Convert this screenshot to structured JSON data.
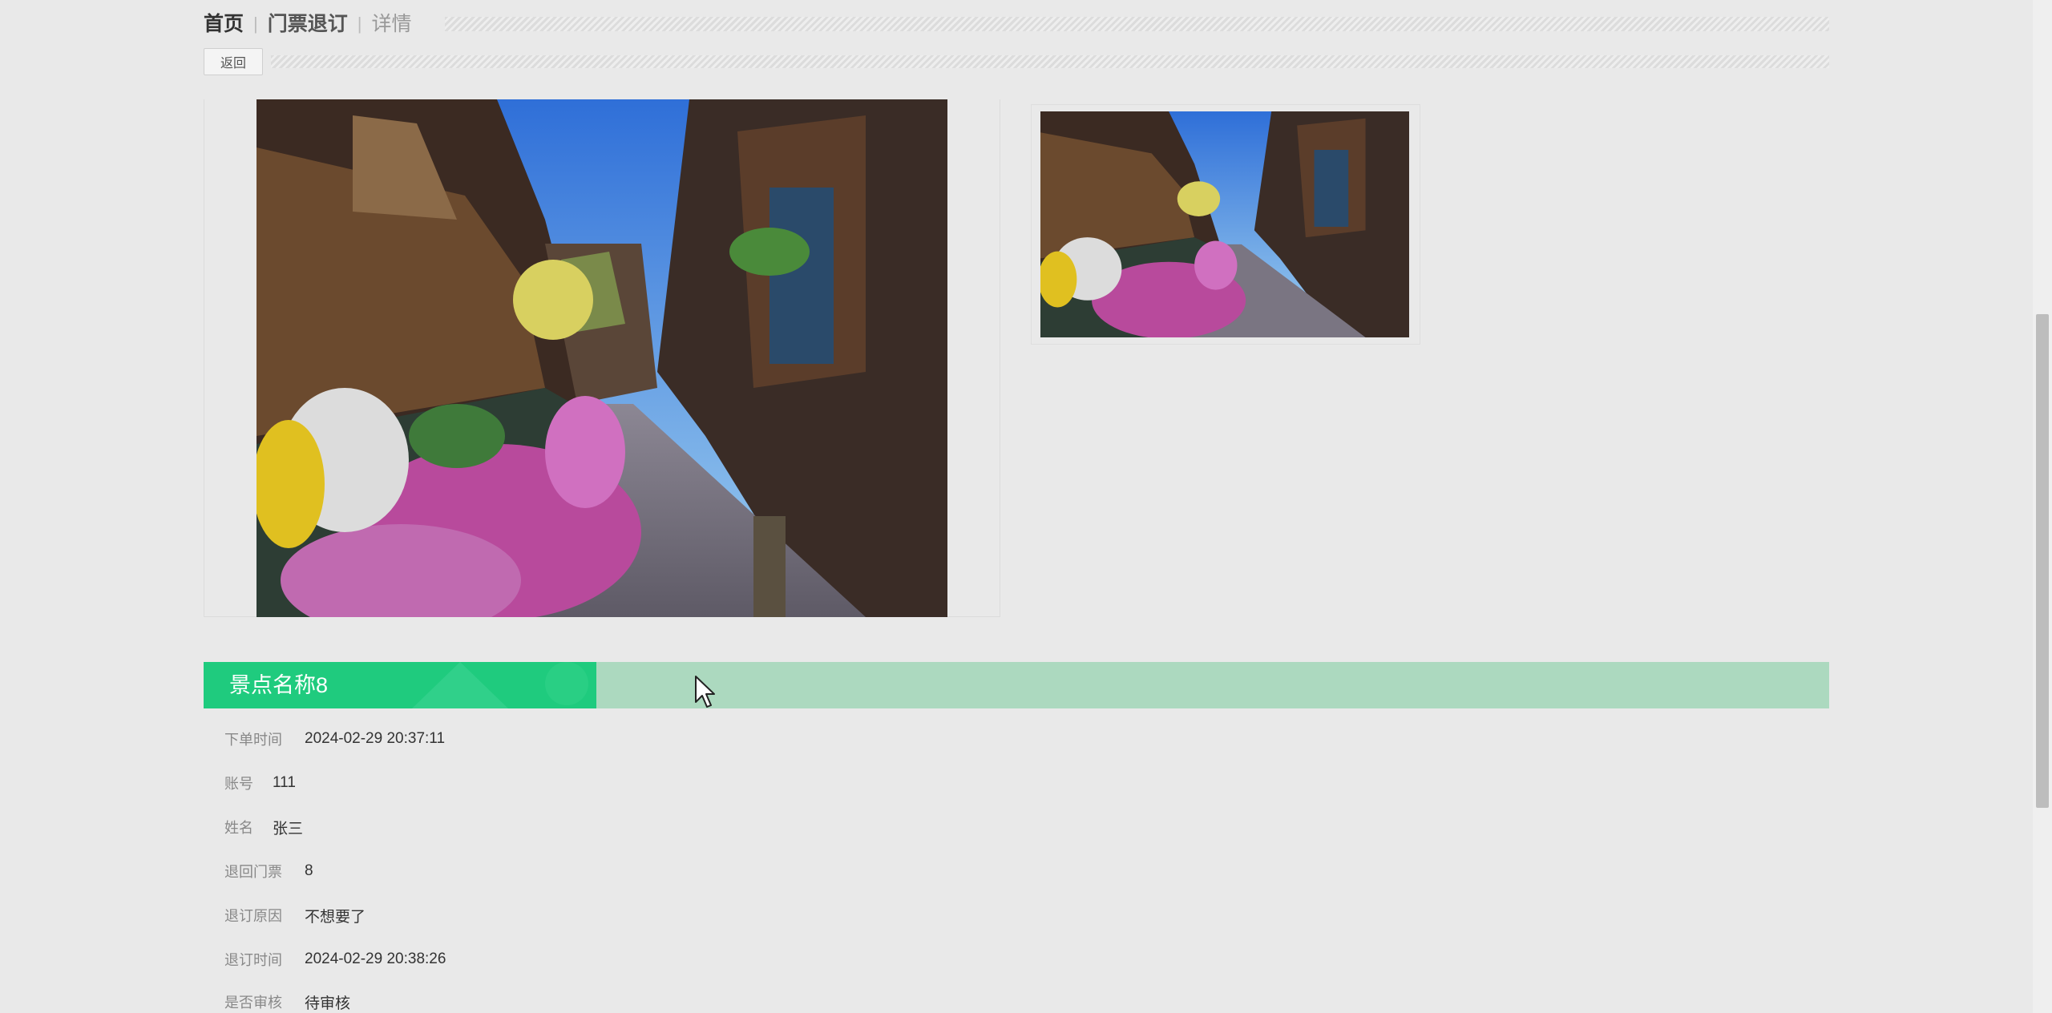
{
  "breadcrumb": {
    "home": "首页",
    "section": "门票退订",
    "current": "详情"
  },
  "toolbar": {
    "back_label": "返回"
  },
  "gallery": {
    "main_image": "street-scene-image",
    "thumb_image": "street-scene-thumbnail"
  },
  "detail": {
    "title": "景点名称8",
    "fields": [
      {
        "label": "下单时间",
        "value": "2024-02-29 20:37:11"
      },
      {
        "label": "账号",
        "value": "111"
      },
      {
        "label": "姓名",
        "value": "张三"
      },
      {
        "label": "退回门票",
        "value": "8"
      },
      {
        "label": "退订原因",
        "value": "不想要了"
      },
      {
        "label": "退订时间",
        "value": "2024-02-29 20:38:26"
      },
      {
        "label": "是否审核",
        "value": "待审核"
      }
    ]
  },
  "colors": {
    "title_accent": "#1fcb7e",
    "title_bar": "#acd9bf",
    "background": "#e9e9e9"
  }
}
